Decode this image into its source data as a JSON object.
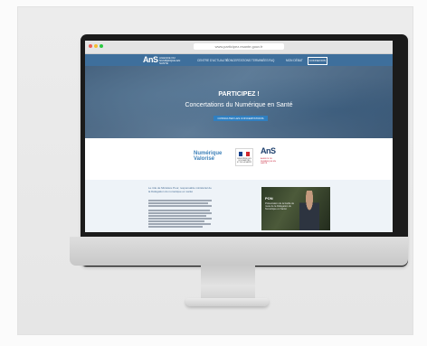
{
  "browser": {
    "url": "www.participez.esante.gouv.fr"
  },
  "site": {
    "logo": "AnS",
    "logo_sub": "AGENCE DU NUMÉRIQUE EN SANTÉ",
    "nav": [
      "CENTRE D'ACTUALITÉ",
      "CONCERTATIONS TERMINÉES",
      "FAQ",
      "MON DÉBAT"
    ],
    "nav_button": "CONNEXION"
  },
  "hero": {
    "title": "PARTICIPEZ !",
    "subtitle": "Concertations du Numérique en Santé",
    "button": "CONSULTER LES CONCERTATIONS"
  },
  "partners": {
    "logo1": "Numérique Valorisé",
    "logo2_text": "MINISTÈRE DES SOLIDARITÉS ET DE LA SANTÉ",
    "logo3": "AnS",
    "logo3_sub": "AGENCE DU NUMÉRIQUE EN SANTÉ"
  },
  "intro": {
    "heading": "Le rôle de Ministère Pour, responsable ministériel de la Délégation du numérique en santé"
  },
  "video": {
    "title": "PON",
    "text": "Présentation de la feuille de route de la Délégation du Numérique en Santé"
  },
  "colors": {
    "nav_blue": "#3e6f9c",
    "accent_blue": "#2f7fc1",
    "ans_red": "#c8243a"
  }
}
